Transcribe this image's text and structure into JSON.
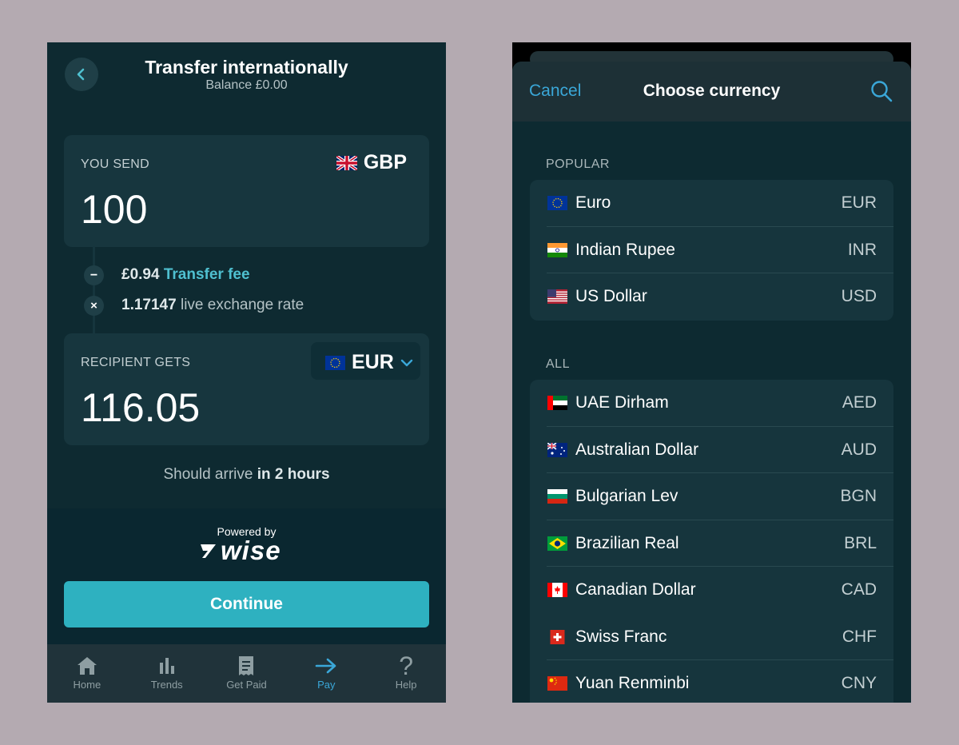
{
  "transfer": {
    "title": "Transfer internationally",
    "balance": "Balance £0.00",
    "send": {
      "label": "YOU SEND",
      "currency": "GBP",
      "amount": "100"
    },
    "fee": {
      "amount": "£0.94",
      "link": "Transfer fee"
    },
    "rate": {
      "value": "1.17147",
      "text": "live exchange rate"
    },
    "receive": {
      "label": "RECIPIENT GETS",
      "currency": "EUR",
      "amount": "116.05"
    },
    "arrival": {
      "prefix": "Should arrive",
      "emphasis": "in 2 hours"
    },
    "powered_by": "Powered by",
    "brand": "wise",
    "continue_label": "Continue"
  },
  "tabs": [
    {
      "label": "Home",
      "icon": "home-icon"
    },
    {
      "label": "Trends",
      "icon": "bar-chart-icon"
    },
    {
      "label": "Get Paid",
      "icon": "receipt-icon"
    },
    {
      "label": "Pay",
      "icon": "arrow-right-icon",
      "active": true
    },
    {
      "label": "Help",
      "icon": "question-icon"
    }
  ],
  "currency_picker": {
    "cancel": "Cancel",
    "title": "Choose currency",
    "popular_label": "POPULAR",
    "all_label": "ALL",
    "popular": [
      {
        "name": "Euro",
        "code": "EUR"
      },
      {
        "name": "Indian Rupee",
        "code": "INR"
      },
      {
        "name": "US Dollar",
        "code": "USD"
      }
    ],
    "all": [
      {
        "name": "UAE Dirham",
        "code": "AED"
      },
      {
        "name": "Australian Dollar",
        "code": "AUD"
      },
      {
        "name": "Bulgarian Lev",
        "code": "BGN"
      },
      {
        "name": "Brazilian Real",
        "code": "BRL"
      },
      {
        "name": "Canadian Dollar",
        "code": "CAD"
      },
      {
        "name": "Swiss Franc",
        "code": "CHF"
      },
      {
        "name": "Yuan Renminbi",
        "code": "CNY"
      }
    ]
  },
  "colors": {
    "accent": "#3aa7d8",
    "button": "#2eb1c0",
    "background": "#0e2a31",
    "frame": "#b4aab1"
  }
}
